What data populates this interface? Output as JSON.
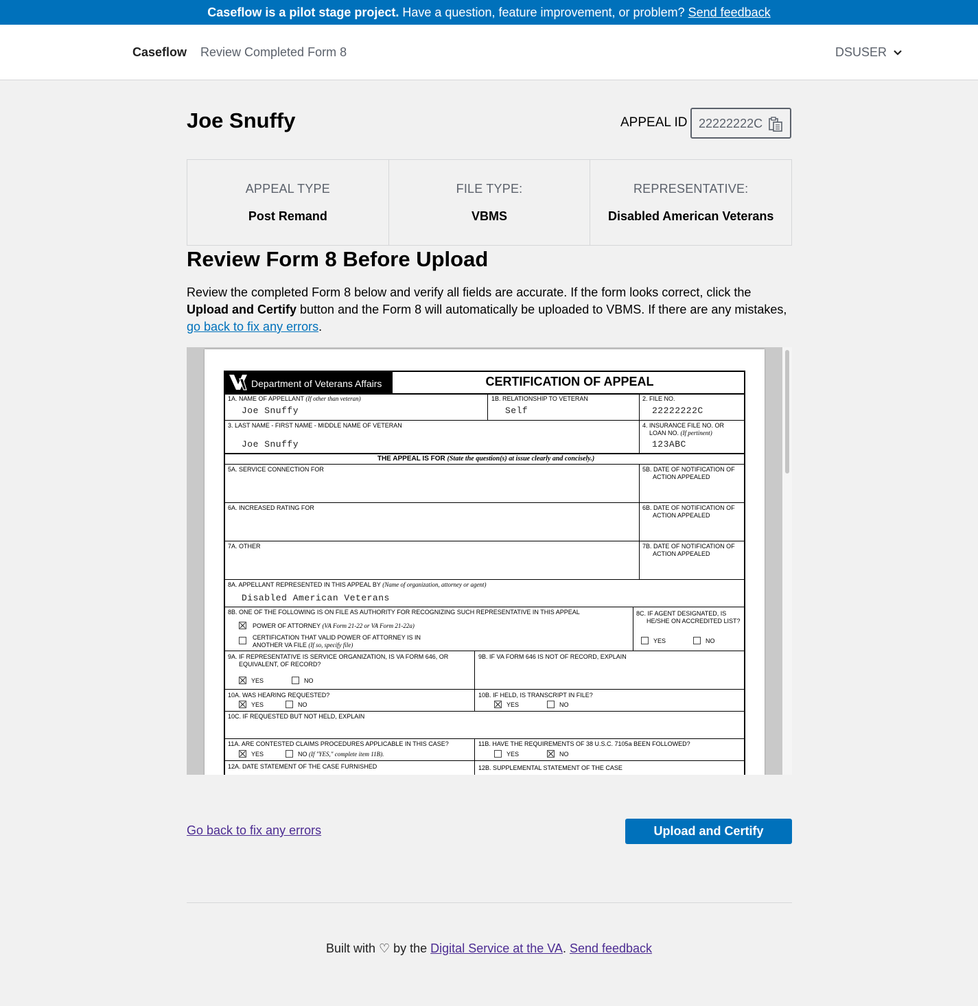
{
  "banner": {
    "bold": "Caseflow is a pilot stage project.",
    "text": " Have a question, feature improvement, or problem? ",
    "link": "Send feedback"
  },
  "nav": {
    "brand": "Caseflow",
    "breadcrumb": "Review Completed Form 8",
    "user": "DSUSER",
    "user_icon": "chevron-down-icon"
  },
  "header": {
    "name": "Joe Snuffy",
    "appeal_id_label": "APPEAL ID",
    "appeal_id": "22222222C",
    "copy_icon": "copy-icon"
  },
  "info": {
    "appeal_type_label": "APPEAL TYPE",
    "appeal_type": "Post Remand",
    "file_type_label": "FILE TYPE:",
    "file_type": "VBMS",
    "representative_label": "REPRESENTATIVE:",
    "representative": "Disabled American Veterans"
  },
  "review": {
    "title": "Review Form 8 Before Upload",
    "p1": "Review the completed Form 8 below and verify all fields are accurate. If the form looks correct, click the ",
    "b1": "Upload and Certify",
    "p2": " button and the Form 8 will automatically be uploaded to VBMS. If there are any mistakes, ",
    "link": "go back to fix any errors",
    "p3": "."
  },
  "form": {
    "dept": "Department of Veterans Affairs",
    "title": "CERTIFICATION OF APPEAL",
    "f1a_label": "1A. NAME OF APPELLANT",
    "f1a_note": "(If other than veteran)",
    "f1a_value": "Joe Snuffy",
    "f1b_label": "1B. RELATIONSHIP TO VETERAN",
    "f1b_value": "Self",
    "f2_label": "2. FILE NO.",
    "f2_value": "22222222C",
    "f3_label": "3. LAST NAME - FIRST NAME - MIDDLE NAME OF VETERAN",
    "f3_value": "Joe Snuffy",
    "f4_label1": "4. INSURANCE FILE NO. OR",
    "f4_label2": "LOAN NO.",
    "f4_note": "(If pertinent)",
    "f4_value": "123ABC",
    "appeal_for": "THE APPEAL IS FOR",
    "appeal_for_note": "(State the question(s) at issue clearly and concisely.)",
    "f5a": "5A. SERVICE CONNECTION FOR",
    "f5b_1": "5B. DATE OF NOTIFICATION OF",
    "f5b_2": "ACTION APPEALED",
    "f6a": "6A. INCREASED RATING FOR",
    "f6b_1": "6B. DATE OF NOTIFICATION OF",
    "f6b_2": "ACTION APPEALED",
    "f7a": "7A. OTHER",
    "f7b_1": "7B. DATE OF NOTIFICATION OF",
    "f7b_2": "ACTION APPEALED",
    "f8a_label": "8A. APPELLANT REPRESENTED IN THIS APPEAL BY",
    "f8a_note": "(Name of organization, attorney or agent)",
    "f8a_value": "Disabled American Veterans",
    "f8b_label": "8B. ONE OF THE FOLLOWING IS ON FILE AS AUTHORITY FOR RECOGNIZING SUCH REPRESENTATIVE IN THIS APPEAL",
    "f8b_opt1": "POWER OF ATTORNEY",
    "f8b_opt1_note": "(VA Form 21-22 or VA Form 21-22a)",
    "f8b_opt2_1": "CERTIFICATION THAT VALID POWER OF ATTORNEY IS IN",
    "f8b_opt2_2": "ANOTHER VA FILE",
    "f8b_opt2_note": "(If so, specify file)",
    "f8c_1": "8C. IF AGENT DESIGNATED, IS",
    "f8c_2": "HE/SHE ON ACCREDITED LIST?",
    "yes": "YES",
    "no": "NO",
    "f9a_1": "9A. IF REPRESENTATIVE IS SERVICE ORGANIZATION, IS VA FORM 646, OR",
    "f9a_2": "EQUIVALENT, OF RECORD?",
    "f9b": "9B. IF VA FORM 646 IS NOT OF RECORD, EXPLAIN",
    "f10a": "10A. WAS HEARING REQUESTED?",
    "f10b": "10B. IF HELD, IS TRANSCRIPT IN FILE?",
    "f10c": "10C. IF REQUESTED BUT NOT HELD, EXPLAIN",
    "f11a": "11A. ARE CONTESTED CLAIMS PROCEDURES APPLICABLE IN THIS CASE?",
    "f11a_no": "NO",
    "f11a_note": "(If \"YES,\" complete item 11B).",
    "f11b": "11B. HAVE THE REQUIREMENTS OF 38 U.S.C. 7105a BEEN FOLLOWED?",
    "f12a": "12A. DATE STATEMENT OF THE CASE FURNISHED",
    "f12b": "12B. SUPPLEMENTAL STATEMENT OF THE CASE"
  },
  "actions": {
    "back": "Go back to fix any errors",
    "upload": "Upload and Certify"
  },
  "footer": {
    "built": "Built with ",
    "heart": "♡",
    "by": " by the ",
    "dsva": "Digital Service at the VA",
    "dot": ". ",
    "feedback": "Send feedback"
  }
}
